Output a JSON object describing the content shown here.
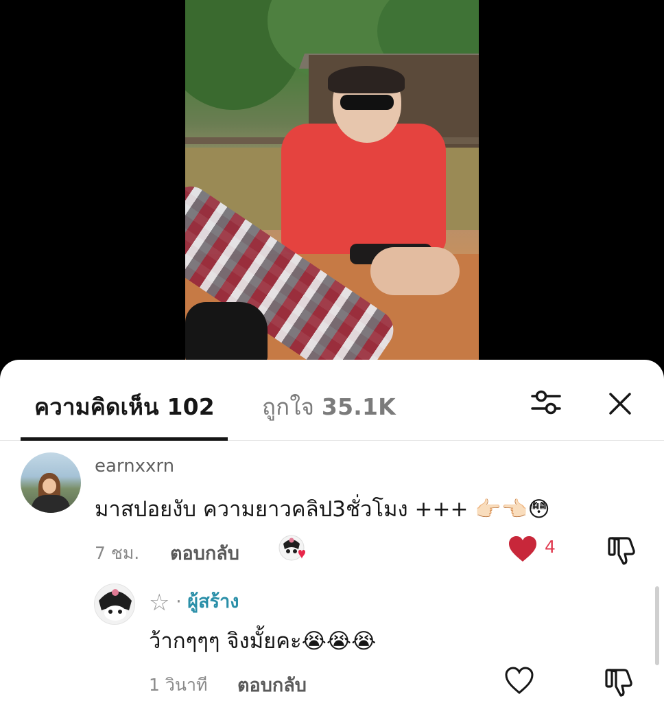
{
  "tabs": {
    "comments_label": "ความคิดเห็น 102",
    "likes_prefix": "ถูกใจ ",
    "likes_count": "35.1K"
  },
  "icons": {
    "filter": "sliders-icon",
    "close": "close-icon",
    "heart_filled": "heart-filled-icon",
    "heart_outline": "heart-outline-icon",
    "dislike": "thumbs-down-icon"
  },
  "comment": {
    "username": "earnxxrn",
    "text": "มาสปอยงับ ความยาวคลิป3ชั่วโมง +++ 👉🏻👈🏻😳",
    "time": "7 ชม.",
    "reply_label": "ตอบกลับ",
    "like_count": "4"
  },
  "reply": {
    "username_symbol": "☆",
    "separator": "·",
    "creator_label": "ผู้สร้าง",
    "text": "ว้ากๆๆๆ จิงมั้ยคะ😭😭😭",
    "time": "1 วินาที",
    "reply_label": "ตอบกลับ"
  },
  "colors": {
    "like_red": "#e03a4f",
    "creator_teal": "#2a8fa8"
  }
}
